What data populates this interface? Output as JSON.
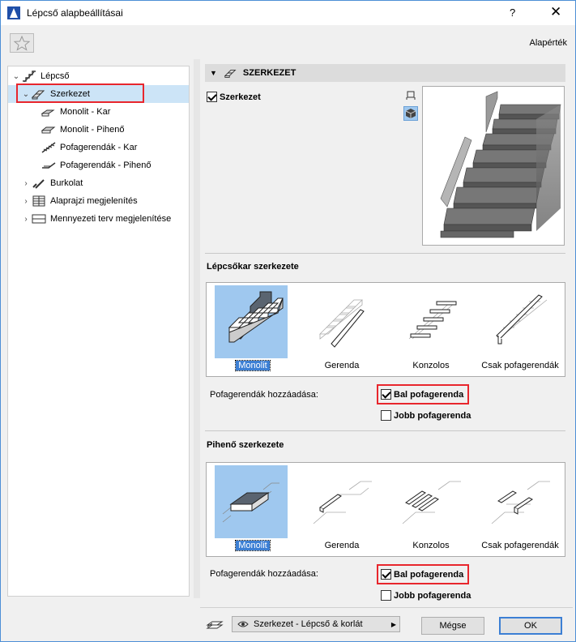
{
  "window": {
    "title": "Lépcső alapbeállításai",
    "help": "?",
    "close": "✕"
  },
  "toolbar": {
    "defaults_label": "Alapérték"
  },
  "tree": {
    "items": [
      {
        "label": "Lépcső",
        "icon": "stair-icon"
      },
      {
        "label": "Szerkezet",
        "icon": "structure-icon"
      },
      {
        "label": "Monolit - Kar",
        "icon": "monolithic-flight-icon"
      },
      {
        "label": "Monolit - Pihenő",
        "icon": "monolithic-landing-icon"
      },
      {
        "label": "Pofagerendák - Kar",
        "icon": "stringer-flight-icon"
      },
      {
        "label": "Pofagerendák - Pihenő",
        "icon": "stringer-landing-icon"
      },
      {
        "label": "Burkolat",
        "icon": "finish-icon"
      },
      {
        "label": "Alaprajzi megjelenítés",
        "icon": "floorplan-icon"
      },
      {
        "label": "Mennyezeti terv megjelenítése",
        "icon": "ceiling-plan-icon"
      }
    ]
  },
  "panel": {
    "header": "SZERKEZET",
    "structure_checkbox": "Szerkezet",
    "flight_section_title": "Lépcsőkar szerkezete",
    "flight_options": [
      "Monolit",
      "Gerenda",
      "Konzolos",
      "Csak pofagerendák"
    ],
    "landing_section_title": "Pihenő szerkezete",
    "landing_options": [
      "Monolit",
      "Gerenda",
      "Konzolos",
      "Csak pofagerendák"
    ],
    "stringers_label": "Pofagerendák hozzáadása:",
    "left_stringer": "Bal pofagerenda",
    "right_stringer": "Jobb pofagerenda"
  },
  "footer": {
    "view_dropdown": "Szerkezet - Lépcső & korlát",
    "cancel": "Mégse",
    "ok": "OK"
  },
  "colors": {
    "selection": "#cce4f7",
    "highlight": "#e8262d",
    "accent": "#3c7fd4",
    "thumb_active": "#9fc8ef"
  }
}
